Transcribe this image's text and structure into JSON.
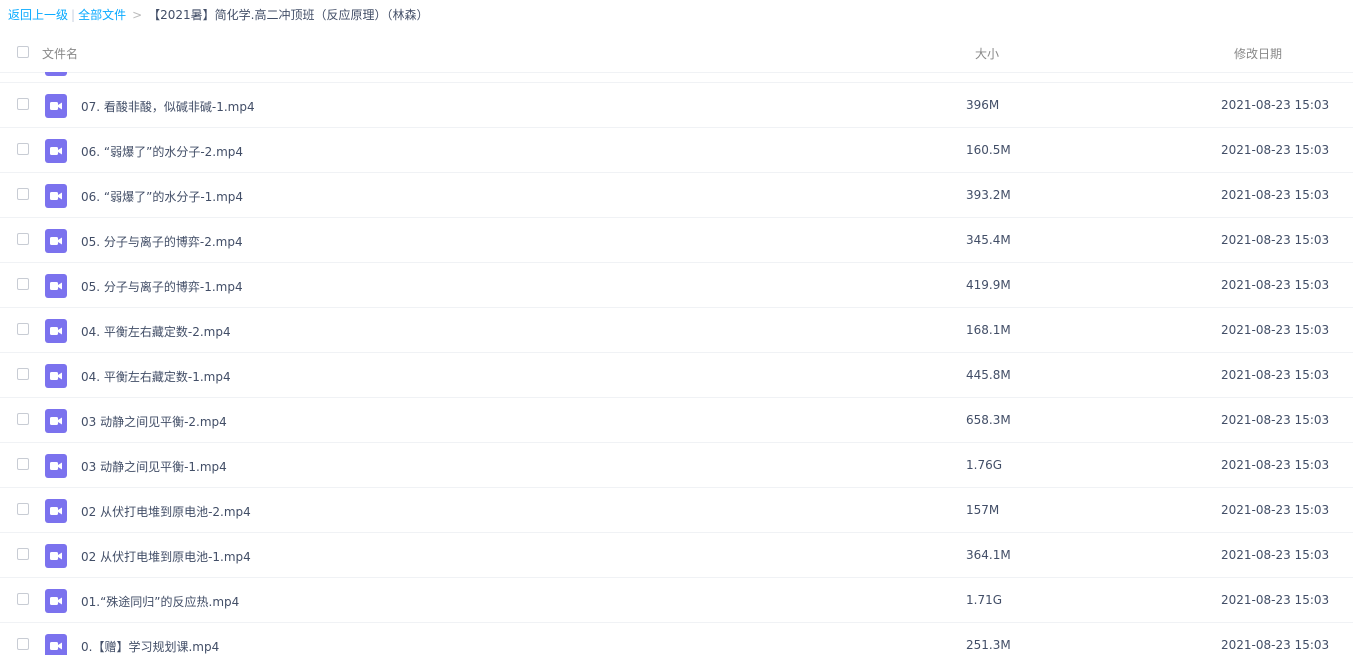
{
  "breadcrumb": {
    "back": "返回上一级",
    "separator": "|",
    "all_files": "全部文件",
    "arrow": ">",
    "current": "【2021暑】简化学.高二冲顶班（反应原理）（林森）"
  },
  "columns": {
    "name": "文件名",
    "size": "大小",
    "modified": "修改日期"
  },
  "icons": {
    "file_type": "video-file-icon",
    "checkbox": "checkbox-icon"
  },
  "colors": {
    "accent_link": "#09aaff",
    "video_icon": "#7b72ee"
  },
  "files": [
    {
      "name": "07. 看酸非酸，似碱非碱-1.mp4",
      "size": "396M",
      "date": "2021-08-23 15:03"
    },
    {
      "name": "06. “弱爆了”的水分子-2.mp4",
      "size": "160.5M",
      "date": "2021-08-23 15:03"
    },
    {
      "name": "06. “弱爆了”的水分子-1.mp4",
      "size": "393.2M",
      "date": "2021-08-23 15:03"
    },
    {
      "name": "05. 分子与离子的博弈-2.mp4",
      "size": "345.4M",
      "date": "2021-08-23 15:03"
    },
    {
      "name": "05. 分子与离子的博弈-1.mp4",
      "size": "419.9M",
      "date": "2021-08-23 15:03"
    },
    {
      "name": "04. 平衡左右藏定数-2.mp4",
      "size": "168.1M",
      "date": "2021-08-23 15:03"
    },
    {
      "name": "04. 平衡左右藏定数-1.mp4",
      "size": "445.8M",
      "date": "2021-08-23 15:03"
    },
    {
      "name": "03 动静之间见平衡-2.mp4",
      "size": "658.3M",
      "date": "2021-08-23 15:03"
    },
    {
      "name": "03 动静之间见平衡-1.mp4",
      "size": "1.76G",
      "date": "2021-08-23 15:03"
    },
    {
      "name": "02 从伏打电堆到原电池-2.mp4",
      "size": "157M",
      "date": "2021-08-23 15:03"
    },
    {
      "name": "02 从伏打电堆到原电池-1.mp4",
      "size": "364.1M",
      "date": "2021-08-23 15:03"
    },
    {
      "name": "01.“殊途同归”的反应热.mp4",
      "size": "1.71G",
      "date": "2021-08-23 15:03"
    },
    {
      "name": "0.【赠】学习规划课.mp4",
      "size": "251.3M",
      "date": "2021-08-23 15:03"
    }
  ]
}
